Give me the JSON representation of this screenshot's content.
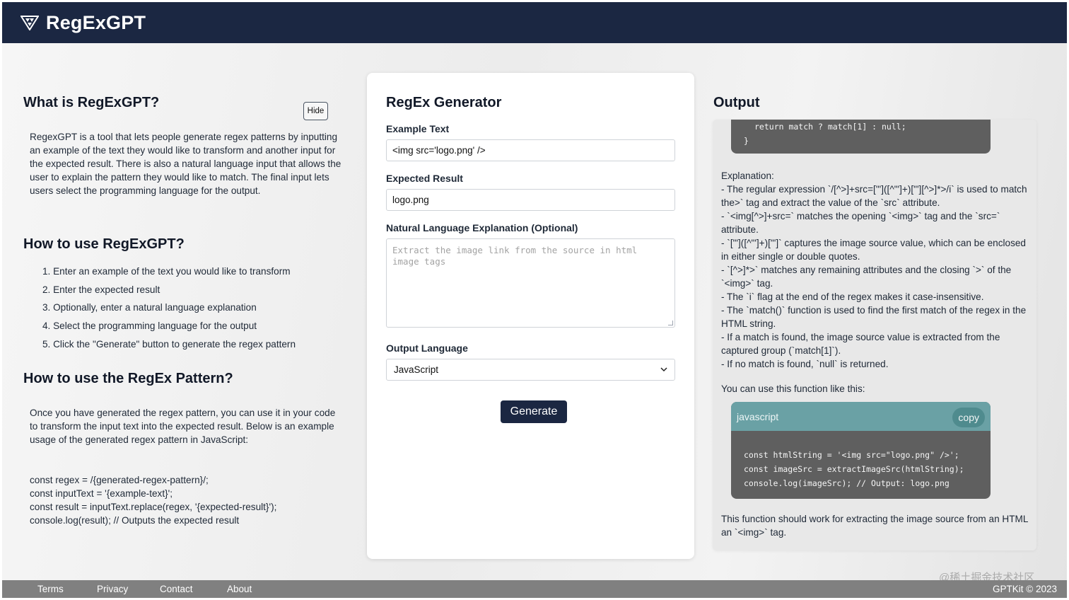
{
  "header": {
    "brand": "RegExGPT"
  },
  "left": {
    "about_title": "What is RegExGPT?",
    "hide_label": "Hide",
    "about_text": "RegexGPT is a tool that lets people generate regex patterns by inputting an example of the text they would like to transform and another input for the expected result. There is also a natural language input that allows the user to explain the pattern they would like to match. The final input lets users select the programming language for the output.",
    "howto_title": "How to use RegExGPT?",
    "steps": [
      "1. Enter an example of the text you would like to transform",
      "2. Enter the expected result",
      "3. Optionally, enter a natural language explanation",
      "4. Select the programming language for the output",
      "5. Click the \"Generate\" button to generate the regex pattern"
    ],
    "pattern_title": "How to use the RegEx Pattern?",
    "pattern_text": "Once you have generated the regex pattern, you can use it in your code to transform the input text into the expected result. Below is an example usage of the generated regex pattern in JavaScript:",
    "code_lines": [
      "const regex = /{generated-regex-pattern}/;",
      "const inputText = '{example-text}';",
      "const result = inputText.replace(regex, '{expected-result}');",
      "console.log(result); // Outputs the expected result"
    ]
  },
  "generator": {
    "title": "RegEx Generator",
    "example_label": "Example Text",
    "example_value": "<img src='logo.png' />",
    "expected_label": "Expected Result",
    "expected_value": "logo.png",
    "nl_label": "Natural Language Explanation (Optional)",
    "nl_placeholder": "Extract the image link from the source in html image tags",
    "lang_label": "Output Language",
    "lang_value": "JavaScript",
    "generate_label": "Generate"
  },
  "output": {
    "title": "Output",
    "code_top_lines": [
      "return match ? match[1] : null;",
      "}"
    ],
    "explanation_lines": [
      "Explanation:",
      "- The regular expression `/[^>]+src=[\"']([^\"']+)[\"'][^>]*>/i` is used to match the>` tag and extract the value of the `src` attribute.",
      "- `<img[^>]+src=` matches the opening `<img>` tag and the `src=` attribute.",
      "- `[\"']([^\"']+)[\"']` captures the image source value, which can be enclosed in either single or double quotes.",
      "- `[^>]*>` matches any remaining attributes and the closing `>` of the `<img>` tag.",
      "- The `i` flag at the end of the regex makes it case-insensitive.",
      "- The `match()` function is used to find the first match of the regex in the HTML string.",
      "- If a match is found, the image source value is extracted from the captured group (`match[1]`).",
      "- If no match is found, `null` is returned."
    ],
    "use_line": "You can use this function like this:",
    "code_lang": "javascript",
    "copy_label": "copy",
    "code_lines": [
      "const htmlString = '<img src=\"logo.png\" />';",
      "const imageSrc = extractImageSrc(htmlString);",
      "console.log(imageSrc); // Output: logo.png"
    ],
    "closing": "This function should work for extracting the image source from an HTML an `<img>` tag."
  },
  "footer": {
    "links": [
      "Terms",
      "Privacy",
      "Contact",
      "About"
    ],
    "copyright": "GPTKit © 2023",
    "watermark": "@稀土掘金技术社区"
  }
}
